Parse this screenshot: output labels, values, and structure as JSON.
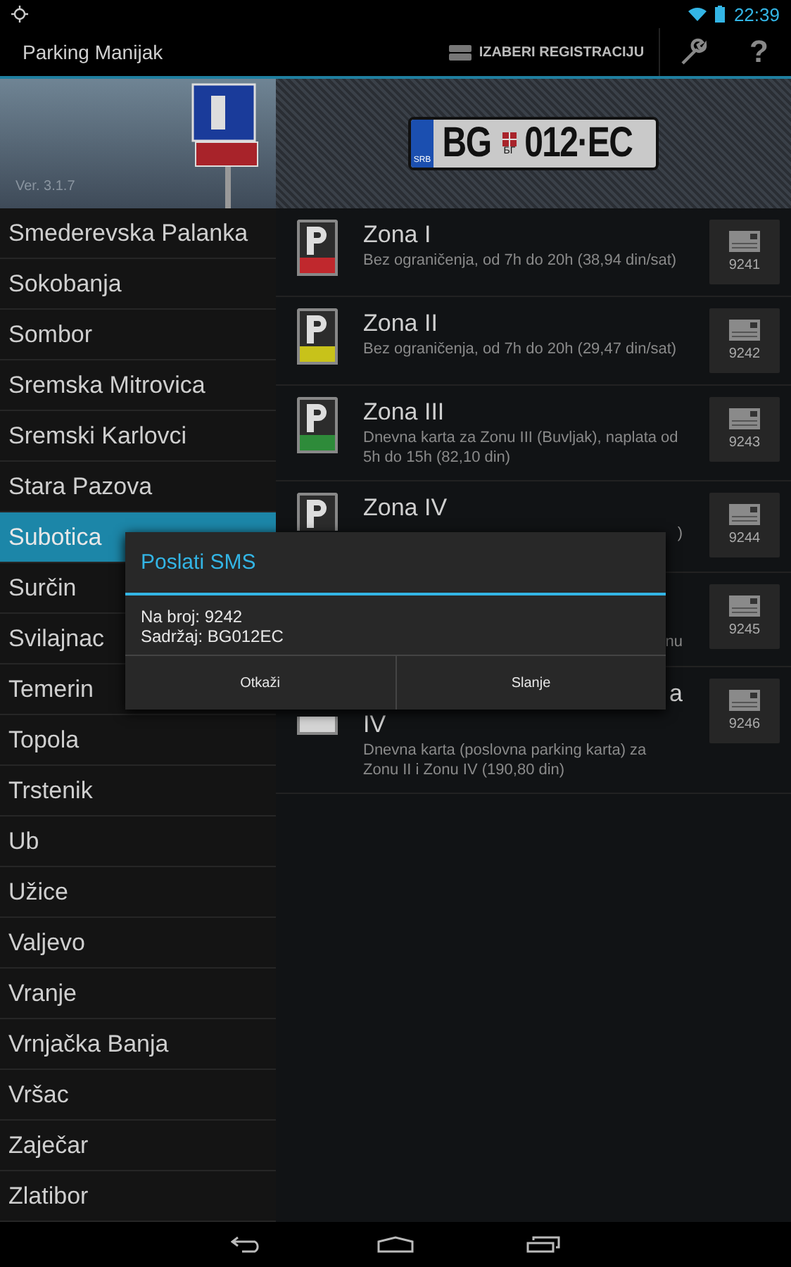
{
  "status_bar": {
    "time": "22:39"
  },
  "action_bar": {
    "title": "Parking Manijak",
    "actions": [
      {
        "kind": "registration",
        "label": "IZABERI REGISTRACIJU"
      },
      {
        "kind": "settings"
      },
      {
        "kind": "help",
        "label": "?"
      }
    ]
  },
  "banner": {
    "version": "Ver. 3.1.7",
    "plate": {
      "country": "SRB",
      "city": "BG",
      "city_cyr": "БГ",
      "number": "012·EC"
    }
  },
  "cities": [
    {
      "name": "Smederevska Palanka",
      "selected": false
    },
    {
      "name": "Sokobanja",
      "selected": false
    },
    {
      "name": "Sombor",
      "selected": false
    },
    {
      "name": "Sremska Mitrovica",
      "selected": false
    },
    {
      "name": "Sremski Karlovci",
      "selected": false
    },
    {
      "name": "Stara Pazova",
      "selected": false
    },
    {
      "name": "Subotica",
      "selected": true
    },
    {
      "name": "Surčin",
      "selected": false
    },
    {
      "name": "Svilajnac",
      "selected": false
    },
    {
      "name": "Temerin",
      "selected": false
    },
    {
      "name": "Topola",
      "selected": false
    },
    {
      "name": "Trstenik",
      "selected": false
    },
    {
      "name": "Ub",
      "selected": false
    },
    {
      "name": "Užice",
      "selected": false
    },
    {
      "name": "Valjevo",
      "selected": false
    },
    {
      "name": "Vranje",
      "selected": false
    },
    {
      "name": "Vrnjačka Banja",
      "selected": false
    },
    {
      "name": "Vršac",
      "selected": false
    },
    {
      "name": "Zaječar",
      "selected": false
    },
    {
      "name": "Zlatibor",
      "selected": false
    }
  ],
  "zones": [
    {
      "kind": "sign",
      "color": "#c0282d",
      "title": "Zona I",
      "description": "Bez ograničenja, od 7h do 20h (38,94 din/sat)",
      "code": "9241"
    },
    {
      "kind": "sign",
      "color": "#c8c21a",
      "title": "Zona II",
      "description": "Bez ograničenja, od 7h do 20h (29,47 din/sat)",
      "code": "9242"
    },
    {
      "kind": "sign",
      "color": "#2e8b3a",
      "title": "Zona III",
      "description": "Dnevna karta za Zonu III (Buvljak), naplata od 5h do 15h (82,10 din)",
      "code": "9243"
    },
    {
      "kind": "sign_top",
      "title": "Zona IV",
      "description_tail": ")",
      "code": "9244"
    },
    {
      "kind": "plain",
      "description_tail": "nu",
      "code": "9245"
    },
    {
      "kind": "sign_bottom",
      "color": "#d4d4d4",
      "title_tail": "a",
      "title": "IV",
      "description": "Dnevna karta (poslovna parking karta) za Zonu II i Zonu IV (190,80 din)",
      "code": "9246"
    }
  ],
  "dialog": {
    "title": "Poslati SMS",
    "lines": [
      "Na broj: 9242",
      "Sadržaj: BG012EC"
    ],
    "buttons": [
      "Otkaži",
      "Slanje"
    ]
  }
}
